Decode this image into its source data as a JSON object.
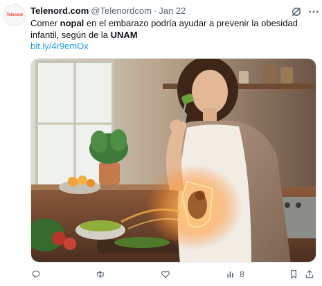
{
  "account": {
    "logo_text": "Telenord",
    "display_name": "Telenord.com",
    "handle": "@Telenordcom",
    "separator": "·",
    "date": "Jan 22"
  },
  "tweet": {
    "text_1": "Comer ",
    "bold_1": "nopal",
    "text_2": " en el embarazo podría ayudar a prevenir la obesidad infantil, según de la ",
    "bold_2": "UNAM",
    "link": "bit.ly/4r9emOx"
  },
  "actions": {
    "views_count": "8"
  },
  "icons": [
    "grok-icon",
    "more-icon",
    "reply-icon",
    "retweet-icon",
    "like-icon",
    "views-icon",
    "bookmark-icon",
    "share-icon"
  ],
  "colors": {
    "accent": "#1d9bf0",
    "muted": "#536471",
    "text": "#0f1419"
  }
}
